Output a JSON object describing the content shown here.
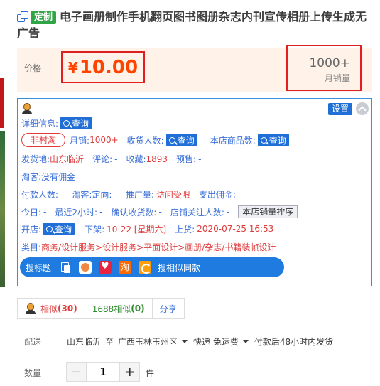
{
  "title": {
    "badge": "定制",
    "text": "电子画册制作手机翻页图书图册杂志内刊宣传相册上传生成无广告"
  },
  "price": {
    "label": "价格",
    "currency": "¥",
    "value": "10.00"
  },
  "sales": {
    "count": "1000+",
    "label": "月销量"
  },
  "plugin": {
    "settings_label": "设置",
    "detail_label": "详细信息:",
    "query_label": "查询",
    "row2": {
      "tag": "非村淘",
      "monthly_label": "月销:",
      "monthly_value": "1000+",
      "buyers_label": "收货人数:",
      "store_items_label": "本店商品数:"
    },
    "row3": {
      "origin_label": "发货地:",
      "origin_value": "山东临沂",
      "review_label": "评论:",
      "review_value": "-",
      "fav_label": "收藏:",
      "fav_value": "1893",
      "presale_label": "预售:",
      "presale_value": "-"
    },
    "row4": {
      "text": "淘客:没有佣金"
    },
    "row5": {
      "paid_label": "付款人数:",
      "paid_value": "-",
      "tk_label": "淘客:定向:",
      "tk_value": "-",
      "promo_label": "推广量:",
      "promo_value": "访问受限",
      "commission_label": "支出佣金:",
      "commission_value": "-"
    },
    "row6": {
      "today_label": "今日:",
      "today_value": "-",
      "recent_label": "最近2小时:",
      "recent_value": "-",
      "confirm_label": "确认收货数:",
      "confirm_value": "-",
      "followers_label": "店铺关注人数:",
      "followers_value": "-",
      "rank_button": "本店销量排序"
    },
    "row7": {
      "open_label": "开店:",
      "off_label": "下架:",
      "off_value": "10-22 [星期六]",
      "up_label": "上货:",
      "up_value": "2020-07-25 16:53"
    },
    "row8": {
      "cat_label": "类目:",
      "cat_value": "商务/设计服务>设计服务>平面设计>画册/杂志/书籍装帧设计"
    },
    "toolbar": {
      "search_title": "搜标题",
      "search_similar": "搜相似同款",
      "icon_c_text": "淘"
    }
  },
  "similar": {
    "similar_label": "相似",
    "similar_count": "(30)",
    "s1688_label": "1688相似",
    "s1688_count": "(0)",
    "share_label": "分享"
  },
  "delivery": {
    "label": "配送",
    "from": "山东临沂",
    "to_word": "至",
    "dest": "广西玉林玉州区",
    "shipping": "快递 免运费",
    "note": "付款后48小时内发货"
  },
  "quantity": {
    "label": "数量",
    "minus": "−",
    "value": "1",
    "plus": "+",
    "unit": "件"
  },
  "colors": {
    "accent": "#1f6fd6",
    "price": "#ff4400",
    "highlight_border": "#e02020",
    "badge_green": "#2fa546"
  }
}
